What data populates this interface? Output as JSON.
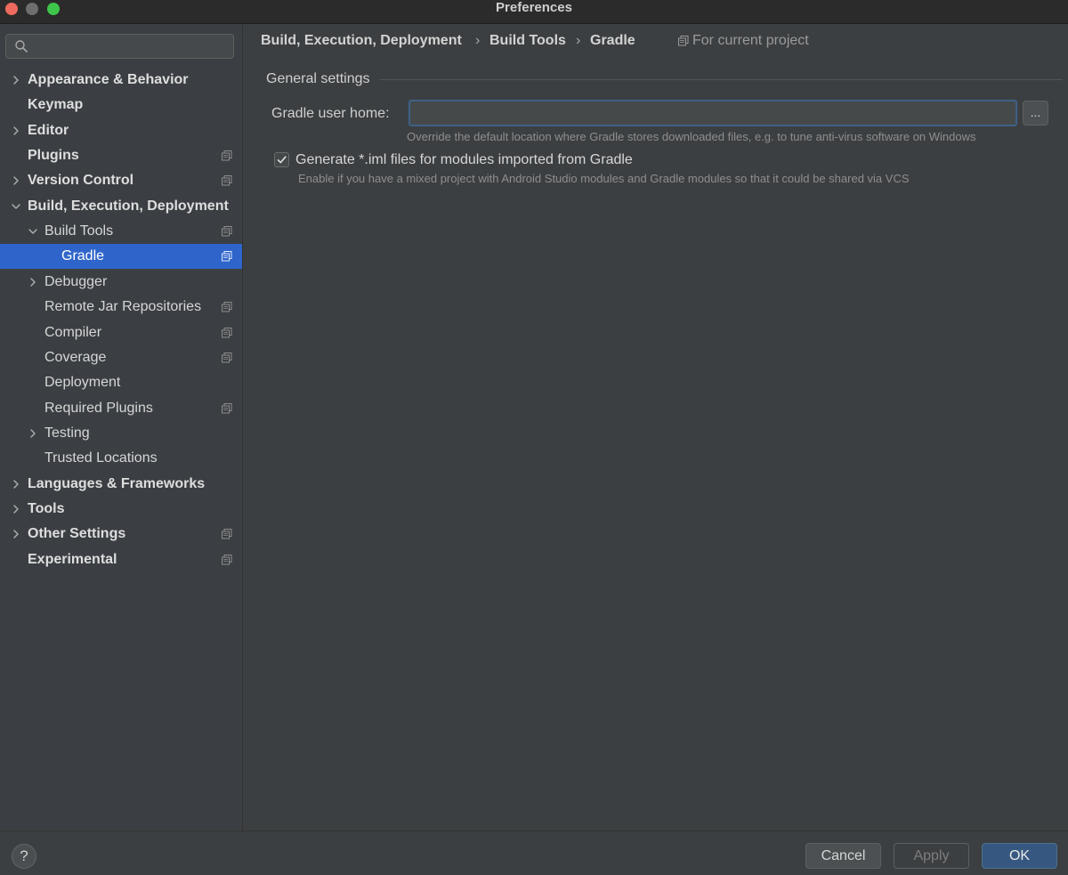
{
  "window": {
    "title": "Preferences"
  },
  "colors": {
    "selection": "#2f65ca",
    "accent_button": "#365880",
    "focus_border": "#3d6185"
  },
  "sidebar": {
    "search_placeholder": "",
    "items": [
      {
        "label": "Appearance & Behavior",
        "bold": true,
        "expander": "collapsed",
        "project_icon": false
      },
      {
        "label": "Keymap",
        "bold": true,
        "expander": "none",
        "project_icon": false
      },
      {
        "label": "Editor",
        "bold": true,
        "expander": "collapsed",
        "project_icon": false
      },
      {
        "label": "Plugins",
        "bold": true,
        "expander": "none",
        "project_icon": true
      },
      {
        "label": "Version Control",
        "bold": true,
        "expander": "collapsed",
        "project_icon": true
      },
      {
        "label": "Build, Execution, Deployment",
        "bold": true,
        "expander": "expanded",
        "project_icon": false
      },
      {
        "label": "Build Tools",
        "bold": false,
        "expander": "expanded",
        "project_icon": true
      },
      {
        "label": "Gradle",
        "bold": false,
        "expander": "none",
        "project_icon": true,
        "selected": true
      },
      {
        "label": "Debugger",
        "bold": false,
        "expander": "collapsed",
        "project_icon": false
      },
      {
        "label": "Remote Jar Repositories",
        "bold": false,
        "expander": "none",
        "project_icon": true
      },
      {
        "label": "Compiler",
        "bold": false,
        "expander": "none",
        "project_icon": true
      },
      {
        "label": "Coverage",
        "bold": false,
        "expander": "none",
        "project_icon": true
      },
      {
        "label": "Deployment",
        "bold": false,
        "expander": "none",
        "project_icon": false
      },
      {
        "label": "Required Plugins",
        "bold": false,
        "expander": "none",
        "project_icon": true
      },
      {
        "label": "Testing",
        "bold": false,
        "expander": "collapsed",
        "project_icon": false
      },
      {
        "label": "Trusted Locations",
        "bold": false,
        "expander": "none",
        "project_icon": false
      },
      {
        "label": "Languages & Frameworks",
        "bold": true,
        "expander": "collapsed",
        "project_icon": false
      },
      {
        "label": "Tools",
        "bold": true,
        "expander": "collapsed",
        "project_icon": false
      },
      {
        "label": "Other Settings",
        "bold": true,
        "expander": "collapsed",
        "project_icon": true
      },
      {
        "label": "Experimental",
        "bold": true,
        "expander": "none",
        "project_icon": true
      }
    ]
  },
  "breadcrumb": {
    "items": [
      "Build, Execution, Deployment",
      "Build Tools",
      "Gradle"
    ],
    "separator": "›",
    "scope_label": "For current project"
  },
  "general_settings": {
    "section_title": "General settings",
    "gradle_user_home_label": "Gradle user home:",
    "gradle_user_home_value": "",
    "browse_label": "...",
    "gradle_user_home_hint": "Override the default location where Gradle stores downloaded files, e.g. to tune anti-virus software on Windows",
    "generate_iml_label": "Generate *.iml files for modules imported from Gradle",
    "generate_iml_checked": true,
    "generate_iml_hint": "Enable if you have a mixed project with Android Studio modules and Gradle modules so that it could be shared via VCS"
  },
  "footer": {
    "help_label": "?",
    "cancel_label": "Cancel",
    "apply_label": "Apply",
    "apply_enabled": false,
    "ok_label": "OK"
  }
}
